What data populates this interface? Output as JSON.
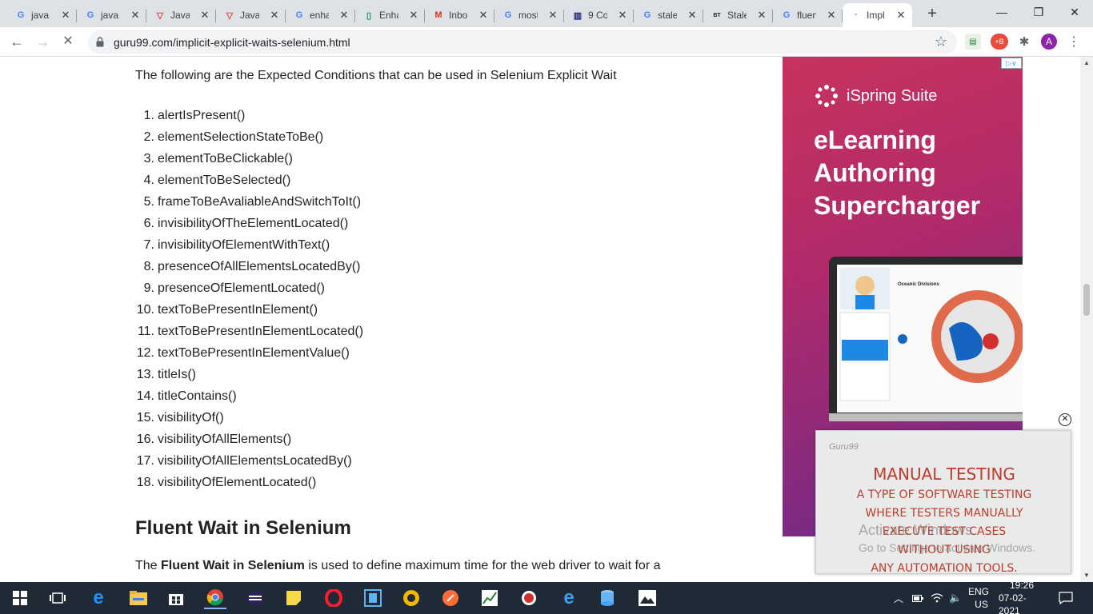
{
  "browser": {
    "tabs": [
      {
        "label": "java",
        "icon": "google-g-icon",
        "color": "#4285f4",
        "glyph": "G"
      },
      {
        "label": "java",
        "icon": "google-g-icon",
        "color": "#4285f4",
        "glyph": "G"
      },
      {
        "label": "Java",
        "icon": "vivaldi-v-icon",
        "color": "#e8453c",
        "glyph": "▽"
      },
      {
        "label": "Java",
        "icon": "vivaldi-v-icon",
        "color": "#e8453c",
        "glyph": "▽"
      },
      {
        "label": "enha",
        "icon": "google-g-icon",
        "color": "#4285f4",
        "glyph": "G"
      },
      {
        "label": "Enha",
        "icon": "sheets-icon",
        "color": "#0f9d58",
        "glyph": "▯"
      },
      {
        "label": "Inbo",
        "icon": "gmail-icon",
        "color": "#d93025",
        "glyph": "M"
      },
      {
        "label": "most",
        "icon": "google-g-icon",
        "color": "#4285f4",
        "glyph": "G"
      },
      {
        "label": "9 Co",
        "icon": "chart-favicon-icon",
        "color": "#1a237e",
        "glyph": "▥"
      },
      {
        "label": "stale",
        "icon": "google-g-icon",
        "color": "#4285f4",
        "glyph": "G"
      },
      {
        "label": "Stale",
        "icon": "bt-favicon-icon",
        "color": "#222222",
        "glyph": "BT"
      },
      {
        "label": "fluen",
        "icon": "google-g-icon",
        "color": "#4285f4",
        "glyph": "G"
      },
      {
        "label": "Impl",
        "icon": "loading-spinner-icon",
        "color": "#4285f4",
        "glyph": "·",
        "active": true
      }
    ],
    "new_tab": "+",
    "window_controls": {
      "minimize": "—",
      "restore": "❐",
      "close": "✕"
    },
    "url": "guru99.com/implicit-explicit-waits-selenium.html",
    "profile_initial": "A"
  },
  "page": {
    "intro": "The following are the Expected Conditions that can be used in Selenium Explicit Wait",
    "conditions": [
      {
        "num": "1.",
        "text": "alertIsPresent()"
      },
      {
        "num": "2.",
        "text": "elementSelectionStateToBe()"
      },
      {
        "num": "3.",
        "text": "elementToBeClickable()"
      },
      {
        "num": "4.",
        "text": "elementToBeSelected()"
      },
      {
        "num": "5.",
        "text": "frameToBeAvaliableAndSwitchToIt()"
      },
      {
        "num": "6.",
        "text": "invisibilityOfTheElementLocated()"
      },
      {
        "num": "7.",
        "text": "invisibilityOfElementWithText()"
      },
      {
        "num": "8.",
        "text": "presenceOfAllElementsLocatedBy()"
      },
      {
        "num": "9.",
        "text": "presenceOfElementLocated()"
      },
      {
        "num": "10.",
        "text": "textToBePresentInElement()"
      },
      {
        "num": "11.",
        "text": "textToBePresentInElementLocated()"
      },
      {
        "num": "12.",
        "text": "textToBePresentInElementValue()"
      },
      {
        "num": "13.",
        "text": "titleIs()"
      },
      {
        "num": "14.",
        "text": "titleContains()"
      },
      {
        "num": "15.",
        "text": "visibilityOf()"
      },
      {
        "num": "16.",
        "text": "visibilityOfAllElements()"
      },
      {
        "num": "17.",
        "text": "visibilityOfAllElementsLocatedBy()"
      },
      {
        "num": "18.",
        "text": "visibilityOfElementLocated()"
      }
    ],
    "heading": "Fluent Wait in Selenium",
    "para_prefix": "The ",
    "para_bold": "Fluent Wait in Selenium",
    "para_suffix": " is used to define maximum time for the web driver to wait for a"
  },
  "ad": {
    "brand": "iSpring Suite",
    "headline_line1": "eLearning",
    "headline_line2": "Authoring",
    "headline_line3": "Supercharger",
    "choice_label": "▷∨",
    "screen_title": "Oceanic Divisions"
  },
  "video": {
    "logo": "Guru99",
    "line1": "MANUAL TESTING",
    "line2": "A TYPE OF SOFTWARE TESTING",
    "line3": "WHERE TESTERS MANUALLY",
    "line4": "EXECUTE TEST CASES",
    "line5": "WITHOUT USING",
    "line6": "ANY AUTOMATION TOOLS.",
    "close": "✕"
  },
  "watermark": {
    "line1": "Activate Windows",
    "line2": "Go to Settings to activate Windows."
  },
  "taskbar": {
    "lang_top": "ENG",
    "lang_bottom": "US",
    "time": "19:26",
    "date": "07-02-2021"
  }
}
